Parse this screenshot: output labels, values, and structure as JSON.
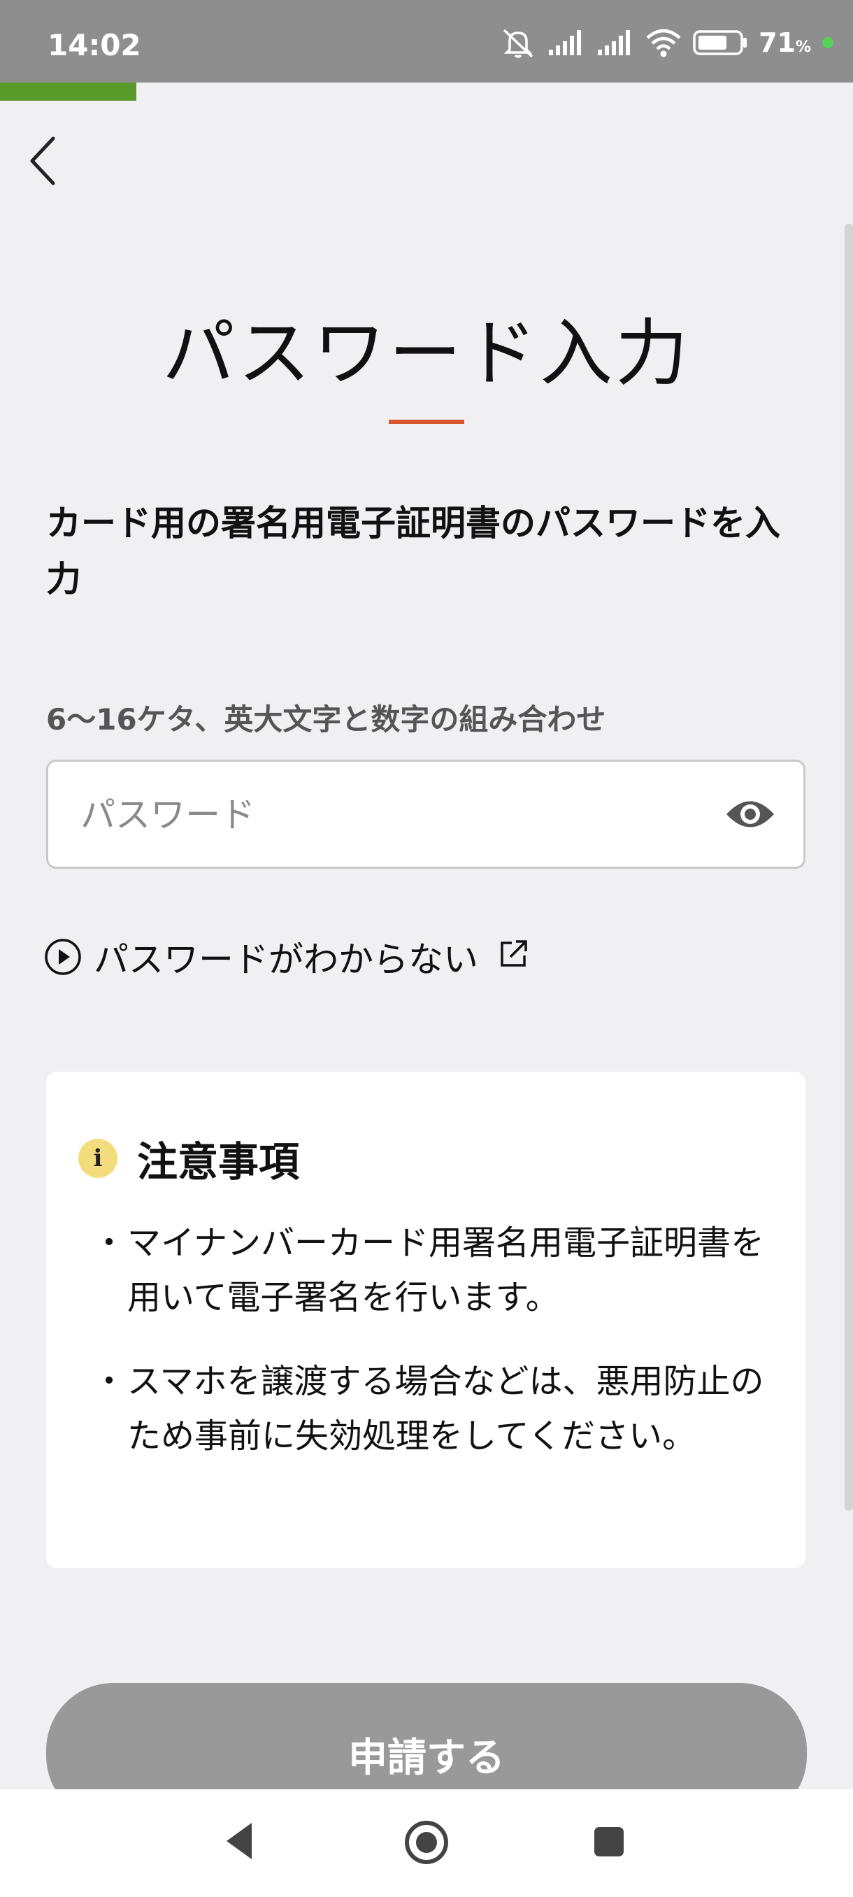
{
  "status_bar": {
    "time": "14:02",
    "battery_percent": "71",
    "battery_unit": "%",
    "icons": [
      "mute-icon",
      "signal-icon",
      "signal-icon",
      "wifi-icon",
      "battery-icon"
    ]
  },
  "progress": {
    "fraction": 0.16,
    "color": "#5a9a2a"
  },
  "header": {
    "back_icon": "chevron-left-icon"
  },
  "page": {
    "title": "パスワード入力",
    "accent_color": "#d8542a",
    "instruction": "カード用の署名用電子証明書のパスワードを入力"
  },
  "password": {
    "hint": "6〜16ケタ、英大文字と数字の組み合わせ",
    "placeholder": "パスワード",
    "value": "",
    "toggle_icon": "eye-icon"
  },
  "help_link": {
    "label": "パスワードがわからない",
    "icons": [
      "play-circle-icon",
      "external-link-icon"
    ]
  },
  "notes": {
    "title": "注意事項",
    "icon": "info-icon",
    "items": [
      "マイナンバーカード用署名用電子証明書を用いて電子署名を行います。",
      "スマホを譲渡する場合などは、悪用防止のため事前に失効処理をしてください。"
    ]
  },
  "submit": {
    "label": "申請する",
    "color": "#999999"
  },
  "nav_bar": {
    "icons": [
      "nav-back-icon",
      "nav-home-icon",
      "nav-recent-icon"
    ]
  }
}
